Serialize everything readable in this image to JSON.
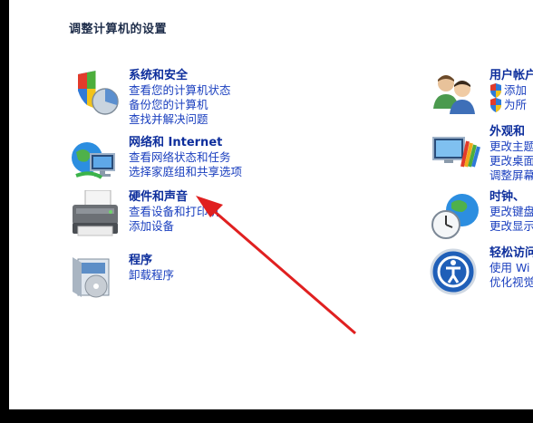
{
  "header": {
    "title": "调整计算机的设置"
  },
  "left_categories": [
    {
      "title": "系统和安全",
      "icon": "shield-security-icon",
      "links": [
        "查看您的计算机状态",
        "备份您的计算机",
        "查找并解决问题"
      ]
    },
    {
      "title": "网络和 Internet",
      "icon": "network-globe-icon",
      "links": [
        "查看网络状态和任务",
        "选择家庭组和共享选项"
      ]
    },
    {
      "title": "硬件和声音",
      "icon": "printer-icon",
      "links": [
        "查看设备和打印机",
        "添加设备"
      ]
    },
    {
      "title": "程序",
      "icon": "programs-box-icon",
      "links": [
        "卸载程序"
      ]
    }
  ],
  "right_categories": [
    {
      "title": "用户帐户",
      "icon": "user-accounts-icon",
      "links": [
        "添加",
        "为所"
      ]
    },
    {
      "title": "外观和",
      "icon": "appearance-monitor-icon",
      "links": [
        "更改主题",
        "更改桌面",
        "调整屏幕"
      ]
    },
    {
      "title": "时钟、",
      "icon": "clock-globe-icon",
      "links": [
        "更改键盘",
        "更改显示"
      ]
    },
    {
      "title": "轻松访问",
      "icon": "ease-of-access-icon",
      "links": [
        "使用 Wi",
        "优化视觉"
      ]
    }
  ],
  "annotation": {
    "icon": "red-arrow-annotation",
    "color": "#e02020"
  },
  "colors": {
    "title": "#0d2e9c",
    "link": "#1a3fbf",
    "heading": "#1e2d4a"
  }
}
